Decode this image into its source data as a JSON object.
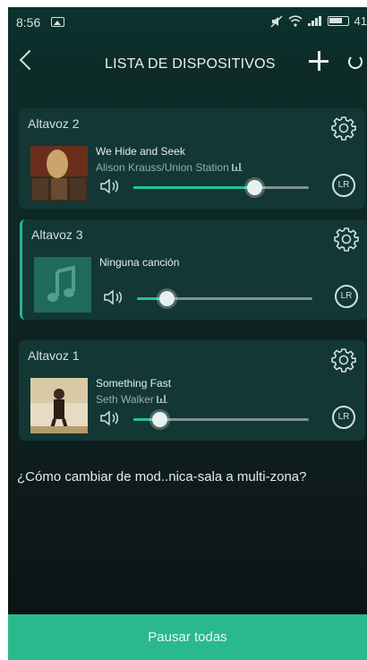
{
  "status_bar": {
    "time": "8:56",
    "battery": "41"
  },
  "header": {
    "title": "LISTA DE DISPOSITIVOS"
  },
  "devices": [
    {
      "name": "Altavoz 2",
      "song": "We Hide and Seek",
      "artist": "Alison Krauss/Union Station",
      "volume": 0.69,
      "channel": "LR",
      "active": false
    },
    {
      "name": "Altavoz 3",
      "song": "Ninguna canción",
      "artist": "",
      "volume": 0.17,
      "channel": "LR",
      "active": true
    },
    {
      "name": "Altavoz 1",
      "song": "Something Fast",
      "artist": "Seth Walker",
      "volume": 0.15,
      "channel": "LR",
      "active": false
    }
  ],
  "help_text": "¿Cómo cambiar de mod..nica-sala a multi-zona?",
  "pause_all": "Pausar todas",
  "colors": {
    "accent": "#2ab98d",
    "card": "#123735"
  }
}
